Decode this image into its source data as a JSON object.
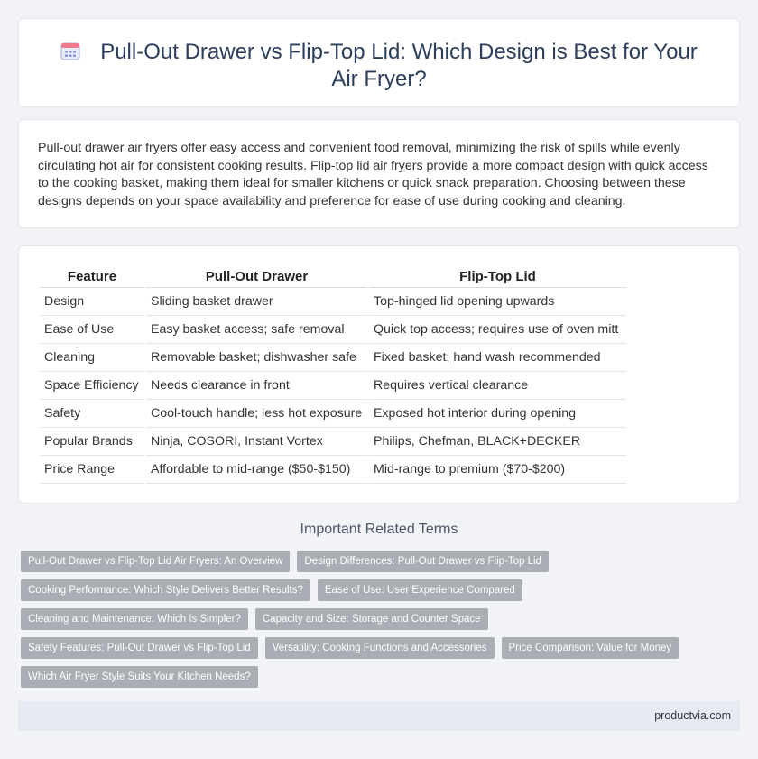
{
  "header": {
    "icon": "calendar-icon",
    "title": "Pull-Out Drawer vs Flip-Top Lid: Which Design is Best for Your Air Fryer?"
  },
  "summary": "Pull-out drawer air fryers offer easy access and convenient food removal, minimizing the risk of spills while evenly circulating hot air for consistent cooking results. Flip-top lid air fryers provide a more compact design with quick access to the cooking basket, making them ideal for smaller kitchens or quick snack preparation. Choosing between these designs depends on your space availability and preference for ease of use during cooking and cleaning.",
  "table": {
    "headers": [
      "Feature",
      "Pull-Out Drawer",
      "Flip-Top Lid"
    ],
    "rows": [
      [
        "Design",
        "Sliding basket drawer",
        "Top-hinged lid opening upwards"
      ],
      [
        "Ease of Use",
        "Easy basket access; safe removal",
        "Quick top access; requires use of oven mitt"
      ],
      [
        "Cleaning",
        "Removable basket; dishwasher safe",
        "Fixed basket; hand wash recommended"
      ],
      [
        "Space Efficiency",
        "Needs clearance in front",
        "Requires vertical clearance"
      ],
      [
        "Safety",
        "Cool-touch handle; less hot exposure",
        "Exposed hot interior during opening"
      ],
      [
        "Popular Brands",
        "Ninja, COSORI, Instant Vortex",
        "Philips, Chefman, BLACK+DECKER"
      ],
      [
        "Price Range",
        "Affordable to mid-range ($50-$150)",
        "Mid-range to premium ($70-$200)"
      ]
    ]
  },
  "related": {
    "title": "Important Related Terms",
    "tags": [
      [
        "Pull-Out Drawer vs Flip-Top Lid Air Fryers: An Overview",
        "Design Differences: Pull-Out Drawer vs Flip-Top Lid"
      ],
      [
        "Cooking Performance: Which Style Delivers Better Results?",
        "Ease of Use: User Experience Compared"
      ],
      [
        "Cleaning and Maintenance: Which Is Simpler?",
        "Capacity and Size: Storage and Counter Space"
      ],
      [
        "Safety Features: Pull-Out Drawer vs Flip-Top Lid",
        "Versatility: Cooking Functions and Accessories",
        "Price Comparison: Value for Money"
      ],
      [
        "Which Air Fryer Style Suits Your Kitchen Needs?"
      ]
    ]
  },
  "footer": {
    "site": "productvia.com"
  },
  "colors": {
    "title": "#2c3e5c",
    "tag_bg": "#a9adb4",
    "footer_bg": "#e6eaf2",
    "icon": "#6b7fd7"
  }
}
